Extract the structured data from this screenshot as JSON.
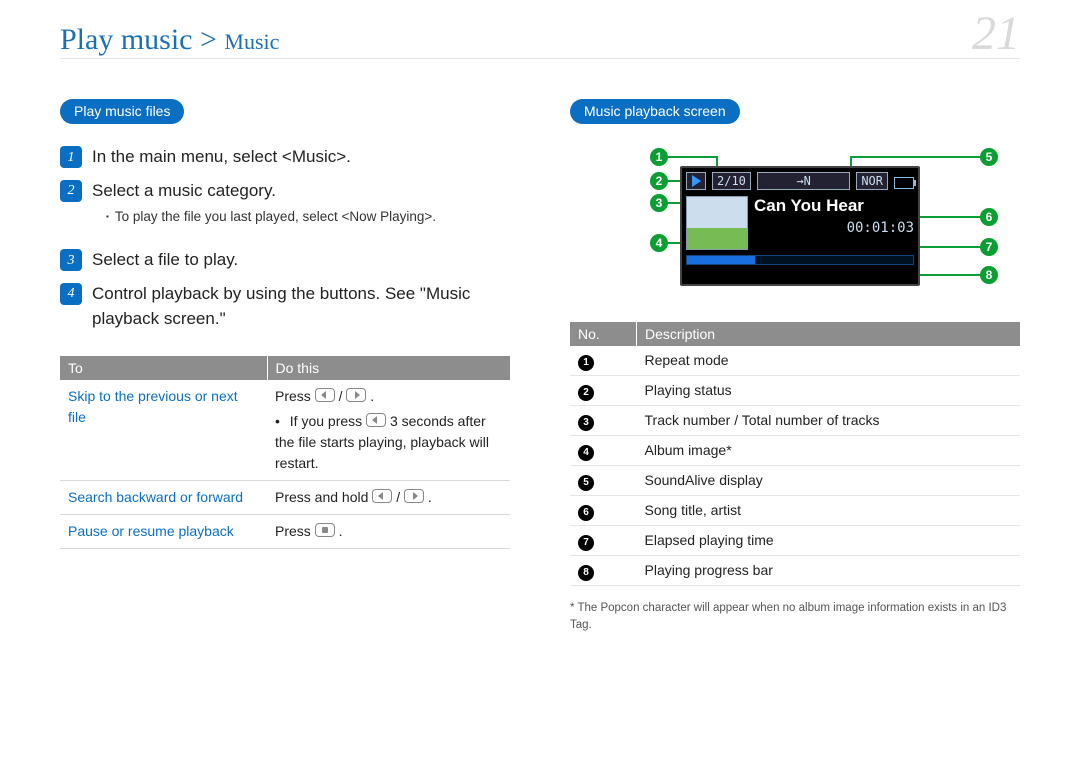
{
  "header": {
    "crumb_main": "Play music >",
    "crumb_sub": "Music",
    "page_number": "21"
  },
  "left": {
    "pill": "Play music files",
    "steps": [
      {
        "n": "1",
        "text": "In the main menu, select <Music>."
      },
      {
        "n": "2",
        "text": "Select a music category.",
        "sub": "To play the file you last played, select <Now Playing>."
      },
      {
        "n": "3",
        "text": "Select a file to play."
      },
      {
        "n": "4",
        "text": "Control playback by using the buttons. See \"Music playback screen.\""
      }
    ],
    "table": {
      "headers": {
        "to": "To",
        "do": "Do this"
      },
      "rows": [
        {
          "to": "Skip to the previous or next file",
          "do_pre": "Press ",
          "do_sep": " / ",
          "do_post": ".",
          "bullet": "If you press ",
          "bullet_mid": " 3 seconds after the file starts playing, playback will restart."
        },
        {
          "to": "Search backward or forward",
          "do_pre": "Press and hold ",
          "do_sep": " / ",
          "do_post": "."
        },
        {
          "to": "Pause or resume playback",
          "do_pre": "Press ",
          "do_post": "."
        }
      ]
    }
  },
  "right": {
    "pill": "Music playback screen",
    "screen": {
      "track_counter": "2/10",
      "repeat_icon_text": "→N",
      "soundalive": "NOR",
      "song_title": "Can You Hear",
      "elapsed": "00:01:03"
    },
    "callouts": [
      "1",
      "2",
      "3",
      "4",
      "5",
      "6",
      "7",
      "8"
    ],
    "desc_table": {
      "headers": {
        "no": "No.",
        "desc": "Description"
      },
      "rows": [
        {
          "n": "1",
          "text": "Repeat mode"
        },
        {
          "n": "2",
          "text": "Playing status"
        },
        {
          "n": "3",
          "text": "Track number / Total number of tracks"
        },
        {
          "n": "4",
          "text": "Album image*"
        },
        {
          "n": "5",
          "text": "SoundAlive display"
        },
        {
          "n": "6",
          "text": "Song title, artist"
        },
        {
          "n": "7",
          "text": "Elapsed playing time"
        },
        {
          "n": "8",
          "text": "Playing progress bar"
        }
      ]
    },
    "footnote": "* The Popcon character will appear when no album image information exists in an ID3 Tag."
  },
  "chart_data": {
    "type": "table",
    "title": "Music playback screen callouts",
    "categories": [
      "1",
      "2",
      "3",
      "4",
      "5",
      "6",
      "7",
      "8"
    ],
    "values": [
      "Repeat mode",
      "Playing status",
      "Track number / Total number of tracks",
      "Album image*",
      "SoundAlive display",
      "Song title, artist",
      "Elapsed playing time",
      "Playing progress bar"
    ]
  }
}
